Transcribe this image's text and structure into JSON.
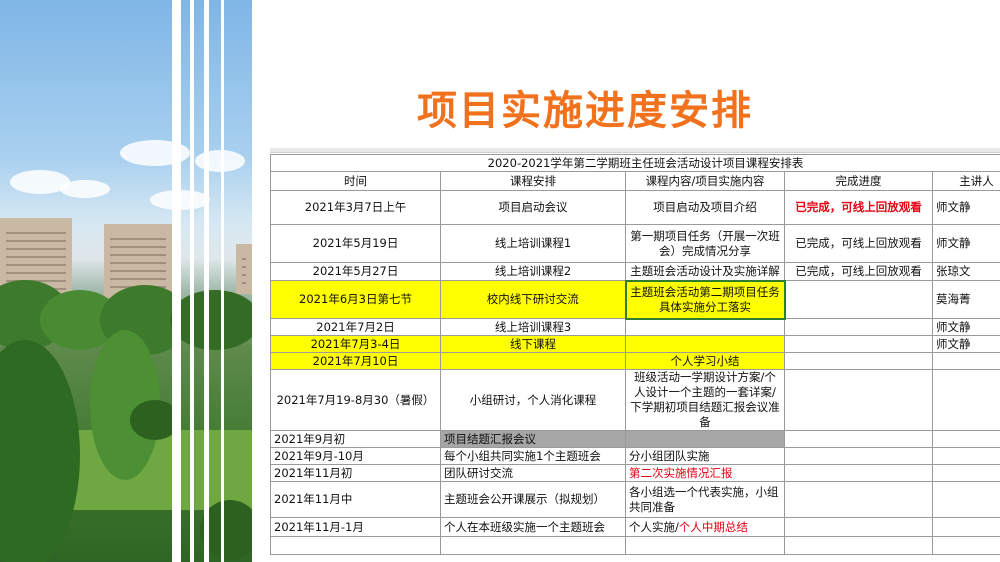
{
  "title": "项目实施进度安排",
  "colors": {
    "title": "#f2711c",
    "highlight": "#ffff00",
    "gray_band": "#a6a6a6",
    "red_text": "#e60012"
  },
  "sheet": {
    "caption": "2020-2021学年第二学期班主任班会活动设计项目课程安排表",
    "headers": [
      "时间",
      "课程安排",
      "课程内容/项目实施内容",
      "完成进度",
      "主讲人"
    ],
    "rows": [
      {
        "time": "2021年3月7日上午",
        "course": "项目启动会议",
        "content": "项目启动及项目介绍",
        "progress": "已完成，可线上回放观看",
        "speaker": "师文静"
      },
      {
        "time": "2021年5月19日",
        "course": "线上培训课程1",
        "content": "第一期项目任务（开展一次班会）完成情况分享",
        "progress": "已完成，可线上回放观看",
        "speaker": "师文静"
      },
      {
        "time": "2021年5月27日",
        "course": "线上培训课程2",
        "content": "主题班会活动设计及实施详解",
        "progress": "已完成，可线上回放观看",
        "speaker": "张琼文"
      },
      {
        "time": "2021年6月3日第七节",
        "course": "校内线下研讨交流",
        "content": "主题班会活动第二期项目任务具体实施分工落实",
        "progress": "",
        "speaker": "莫海菁"
      },
      {
        "time": "2021年7月2日",
        "course": "线上培训课程3",
        "content": "",
        "progress": "",
        "speaker": "师文静"
      },
      {
        "time": "2021年7月3-4日",
        "course": "线下课程",
        "content": "",
        "progress": "",
        "speaker": "师文静"
      },
      {
        "time": "2021年7月10日",
        "course": "",
        "content": "个人学习小结",
        "progress": "",
        "speaker": ""
      },
      {
        "time": "2021年7月19-8月30（暑假）",
        "course": "小组研讨，个人消化课程",
        "content": "班级活动一学期设计方案/个人设计一个主题的一套详案/下学期初项目结题汇报会议准备",
        "progress": "",
        "speaker": ""
      },
      {
        "time": "2021年9月初",
        "course": "项目结题汇报会议",
        "content": "",
        "progress": "",
        "speaker": ""
      },
      {
        "time": "2021年9月-10月",
        "course": "每个小组共同实施1个主题班会",
        "content": "分小组团队实施",
        "progress": "",
        "speaker": ""
      },
      {
        "time": "2021年11月初",
        "course": "团队研讨交流",
        "content": "第二次实施情况汇报",
        "progress": "",
        "speaker": ""
      },
      {
        "time": "2021年11月中",
        "course": "主题班会公开课展示（拟规划）",
        "content": "各小组选一个代表实施，小组共同准备",
        "progress": "",
        "speaker": ""
      },
      {
        "time": "2021年11月-1月",
        "course": "个人在本班级实施一个主题班会",
        "content_a": "个人实施/",
        "content_b": "个人中期总结",
        "progress": "",
        "speaker": ""
      }
    ]
  }
}
